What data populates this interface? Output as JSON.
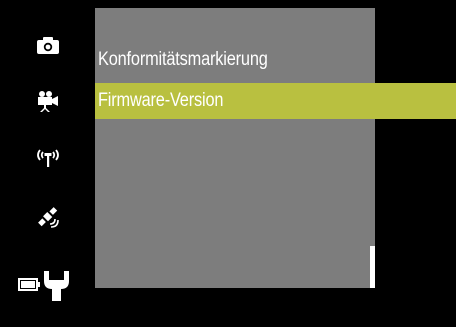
{
  "sidebar": {
    "items": [
      {
        "icon": "camera-icon",
        "active": false
      },
      {
        "icon": "movie-camera-icon",
        "active": false
      },
      {
        "icon": "wireless-icon",
        "active": false
      },
      {
        "icon": "satellite-icon",
        "active": false
      },
      {
        "icon": "wrench-icon",
        "active": true
      }
    ],
    "battery_icon": "battery-icon"
  },
  "menu": {
    "items": [
      {
        "label": "Konformitätsmarkierung",
        "selected": false
      },
      {
        "label": "Firmware-Version",
        "selected": true
      }
    ]
  },
  "colors": {
    "panel": "#7d7d7d",
    "highlight": "#b9c040",
    "background": "#000000",
    "icon": "#ffffff"
  }
}
